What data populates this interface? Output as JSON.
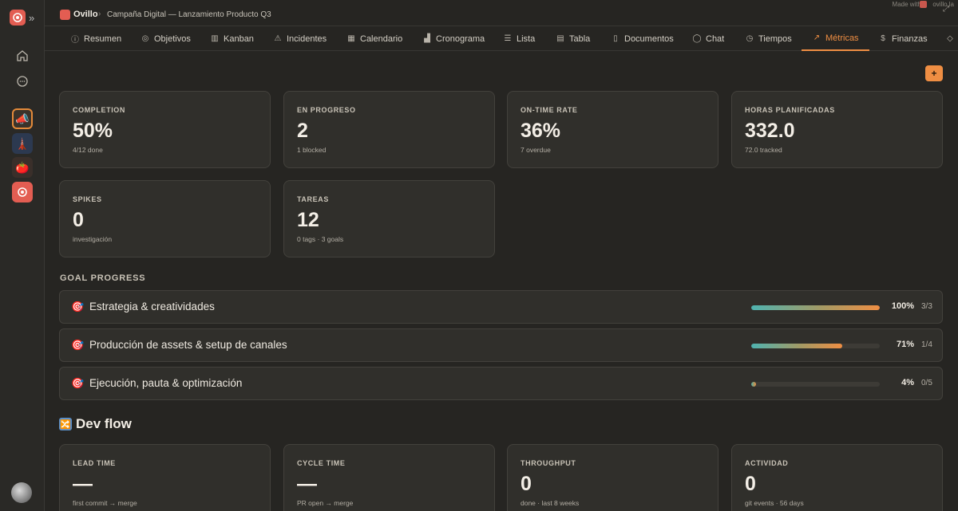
{
  "header": {
    "brand": "Ovillo",
    "separator": "›",
    "breadcrumb": "Campaña Digital — Lanzamiento Producto Q3",
    "made_with": "Made with",
    "made_with_site": "ovillo.la"
  },
  "sidebar": {
    "expand_icon": "»",
    "projects": [
      "📣",
      "🗼",
      "🍅",
      "🧶"
    ]
  },
  "tabs": [
    {
      "label": "Resumen",
      "icon": "ⓘ"
    },
    {
      "label": "Objetivos",
      "icon": "◎"
    },
    {
      "label": "Kanban",
      "icon": "▥"
    },
    {
      "label": "Incidentes",
      "icon": "⚠"
    },
    {
      "label": "Calendario",
      "icon": "▦"
    },
    {
      "label": "Cronograma",
      "icon": "▟"
    },
    {
      "label": "Lista",
      "icon": "☰"
    },
    {
      "label": "Tabla",
      "icon": "▤"
    },
    {
      "label": "Documentos",
      "icon": "▯"
    },
    {
      "label": "Chat",
      "icon": "◯"
    },
    {
      "label": "Tiempos",
      "icon": "◷"
    },
    {
      "label": "Métricas",
      "icon": "↗"
    },
    {
      "label": "Finanzas",
      "icon": "$"
    },
    {
      "label": "",
      "icon": "◇"
    }
  ],
  "active_tab": "Métricas",
  "add_button": "+",
  "stats": [
    {
      "label": "COMPLETION",
      "value": "50%",
      "sub": "4/12 done"
    },
    {
      "label": "EN PROGRESO",
      "value": "2",
      "sub": "1 blocked"
    },
    {
      "label": "ON-TIME RATE",
      "value": "36%",
      "sub": "7 overdue"
    },
    {
      "label": "HORAS PLANIFICADAS",
      "value": "332.0",
      "sub": "72.0 tracked"
    },
    {
      "label": "SPIKES",
      "value": "0",
      "sub": "investigación"
    },
    {
      "label": "TAREAS",
      "value": "12",
      "sub": "0 tags · 3 goals"
    }
  ],
  "goal_progress": {
    "title": "GOAL PROGRESS",
    "goals": [
      {
        "icon": "🎯",
        "name": "Estrategia & creatividades",
        "progress": 1.0,
        "percent": "100%",
        "count": "3/3"
      },
      {
        "icon": "🎯",
        "name": "Producción de assets & setup de canales",
        "progress": 0.71,
        "percent": "71%",
        "count": "1/4"
      },
      {
        "icon": "🎯",
        "name": "Ejecución, pauta & optimización",
        "progress": 0.04,
        "percent": "4%",
        "count": "0/5"
      }
    ]
  },
  "dev_flow": {
    "icon": "🔀",
    "title": "Dev flow",
    "stats": [
      {
        "label": "LEAD TIME",
        "value": "—",
        "sub": "first commit → merge"
      },
      {
        "label": "CYCLE TIME",
        "value": "—",
        "sub": "PR open → merge"
      },
      {
        "label": "THROUGHPUT",
        "value": "0",
        "sub": "done · last 8 weeks"
      },
      {
        "label": "ACTIVIDAD",
        "value": "0",
        "sub": "git events · 56 days"
      }
    ]
  },
  "colors": {
    "accent": "#ef8e43",
    "brand": "#e35d52",
    "progress_start": "#4fb3b0"
  }
}
